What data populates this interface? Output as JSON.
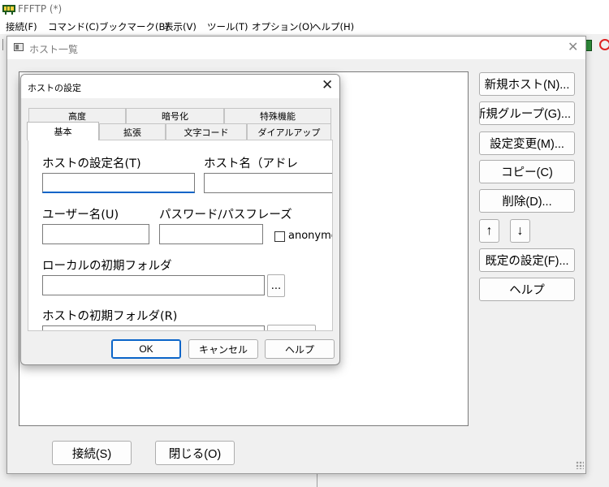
{
  "app": {
    "title": "FFFTP (*)",
    "menu": [
      "接続(F)",
      "コマンド(C)",
      "ブックマーク(B)",
      "表示(V)",
      "ツール(T)",
      "オプション(O)",
      "ヘルプ(H)"
    ]
  },
  "host_list": {
    "title": "ホスト一覧",
    "buttons": {
      "new_host": "新規ホスト(N)...",
      "new_group": "新規グループ(G)...",
      "edit": "設定変更(M)...",
      "copy": "コピー(C)",
      "delete": "削除(D)...",
      "move_up": "↑",
      "move_down": "↓",
      "defaults": "既定の設定(F)...",
      "help": "ヘルプ"
    },
    "bottom_buttons": {
      "connect": "接続(S)",
      "close": "閉じる(O)"
    }
  },
  "dialog": {
    "title": "ホストの設定",
    "tabs_row1": [
      "高度",
      "暗号化",
      "特殊機能"
    ],
    "tabs_row2": [
      "基本",
      "拡張",
      "文字コード",
      "ダイアルアップ"
    ],
    "fields": {
      "host_setting_name_label": "ホストの設定名(T)",
      "host_setting_name_value": "",
      "host_name_label": "ホスト名（アドレ",
      "host_name_value": "",
      "username_label": "ユーザー名(U)",
      "username_value": "",
      "password_label": "パスワード/パスフレーズ",
      "password_value": "",
      "anonymous_label": "anonymous",
      "anonymous_checked": false,
      "local_folder_label": "ローカルの初期フォルダ",
      "local_folder_value": "",
      "host_folder_label": "ホストの初期フォルダ(R)",
      "host_folder_value": "",
      "browse_label": "..."
    },
    "buttons": {
      "ok": "OK",
      "cancel": "キャンセル",
      "help": "ヘルプ"
    }
  },
  "colors": {
    "accent": "#0a64c8",
    "window_bg": "#f0f0f0",
    "field_bg": "#ffffff"
  }
}
